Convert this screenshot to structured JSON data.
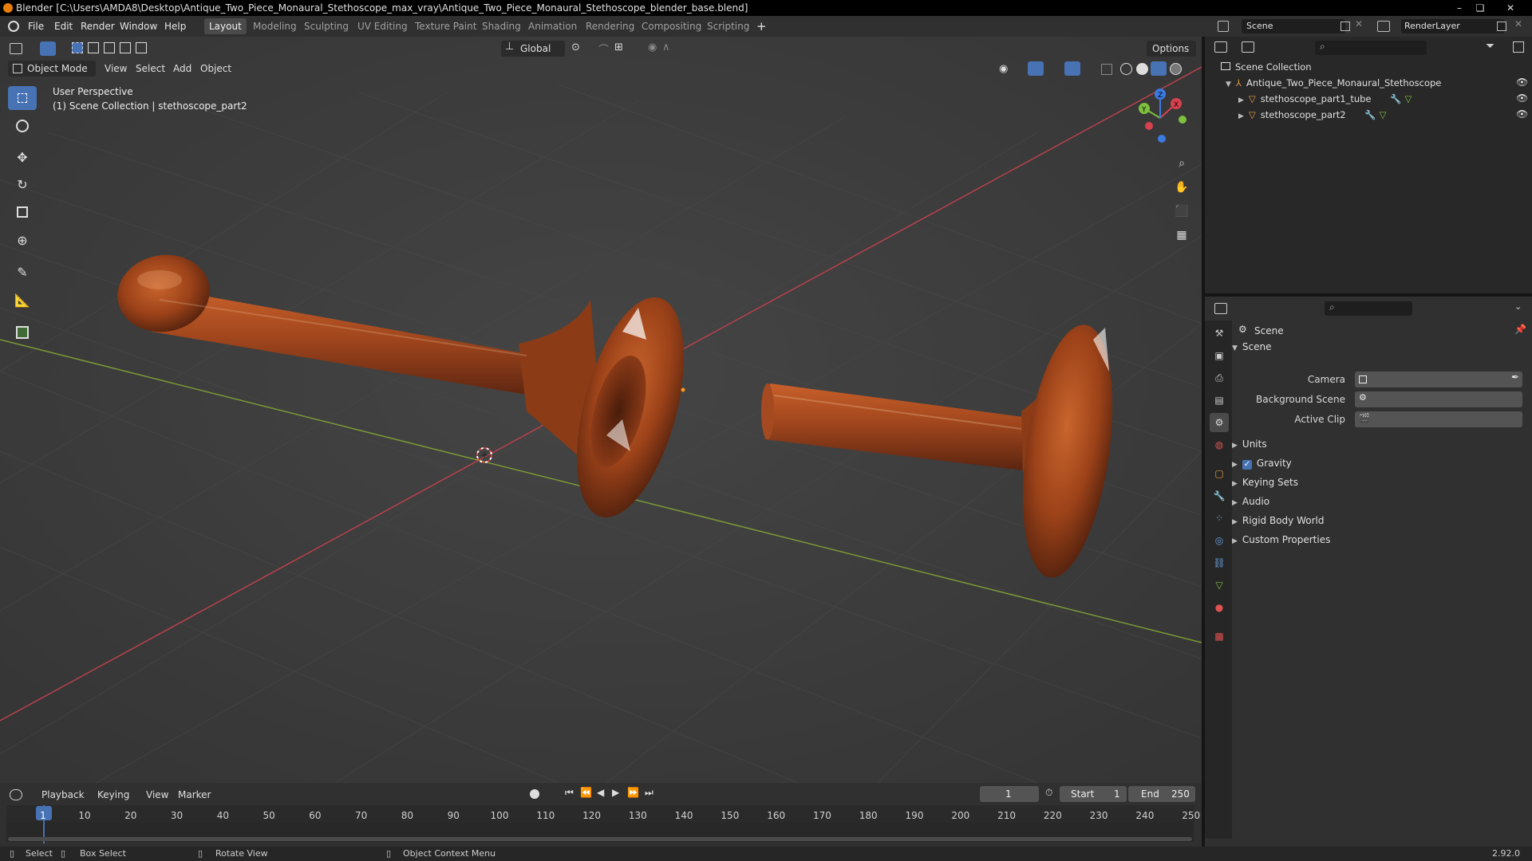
{
  "window": {
    "title": "Blender [C:\\Users\\AMDA8\\Desktop\\Antique_Two_Piece_Monaural_Stethoscope_max_vray\\Antique_Two_Piece_Monaural_Stethoscope_blender_base.blend]",
    "minimize": "–",
    "maximize": "❏",
    "close": "✕"
  },
  "menubar": {
    "menus": [
      "File",
      "Edit",
      "Render",
      "Window",
      "Help"
    ],
    "workspaces": [
      "Layout",
      "Modeling",
      "Sculpting",
      "UV Editing",
      "Texture Paint",
      "Shading",
      "Animation",
      "Rendering",
      "Compositing",
      "Scripting"
    ],
    "active_workspace": "Layout",
    "add_workspace": "+",
    "scene_name": "Scene",
    "view_layer": "RenderLayer"
  },
  "viewport_header": {
    "mode": "Object Mode",
    "menus": [
      "View",
      "Select",
      "Add",
      "Object"
    ],
    "orientation": "Global",
    "options": "Options"
  },
  "viewport": {
    "perspective": "User Perspective",
    "collection_info": "(1) Scene Collection | stethoscope_part2",
    "gizmo_axes": [
      "X",
      "Y",
      "Z"
    ]
  },
  "outliner": {
    "root": "Scene Collection",
    "items": [
      {
        "name": "Antique_Two_Piece_Monaural_Stethoscope",
        "level": 1
      },
      {
        "name": "stethoscope_part1_tube",
        "level": 2
      },
      {
        "name": "stethoscope_part2",
        "level": 2
      }
    ]
  },
  "properties": {
    "context": "Scene",
    "panel_title": "Scene",
    "fields": [
      {
        "label": "Camera",
        "value": ""
      },
      {
        "label": "Background Scene",
        "value": ""
      },
      {
        "label": "Active Clip",
        "value": ""
      }
    ],
    "subpanels": [
      "Units",
      "Gravity",
      "Keying Sets",
      "Audio",
      "Rigid Body World",
      "Custom Properties"
    ],
    "gravity_checked": true
  },
  "timeline": {
    "menus": [
      "Playback",
      "Keying",
      "View",
      "Marker"
    ],
    "current_frame": "1",
    "start_label": "Start",
    "start": "1",
    "end_label": "End",
    "end": "250",
    "ruler": [
      "1",
      "10",
      "20",
      "30",
      "40",
      "50",
      "60",
      "70",
      "80",
      "90",
      "100",
      "110",
      "120",
      "130",
      "140",
      "150",
      "160",
      "170",
      "180",
      "190",
      "200",
      "210",
      "220",
      "230",
      "240",
      "250"
    ]
  },
  "statusbar": {
    "select": "Select",
    "box_select": "Box Select",
    "rotate_view": "Rotate View",
    "context_menu": "Object Context Menu",
    "version": "2.92.0"
  },
  "colors": {
    "accent": "#4772b3",
    "x_axis": "#d8414f",
    "y_axis": "#7fbf3f",
    "z_axis": "#3b7ae0",
    "wood": "#a1461d"
  }
}
